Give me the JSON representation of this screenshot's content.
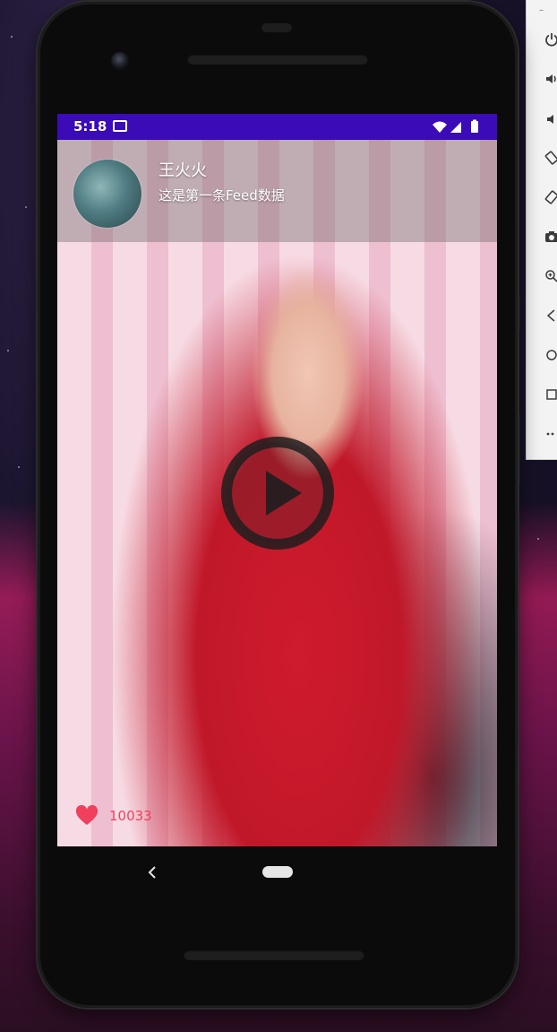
{
  "status_bar": {
    "time": "5:18"
  },
  "feed": {
    "author_name": "王火火",
    "description": "这是第一条Feed数据",
    "like_count": "10033"
  },
  "emulator_toolbar": {
    "items": [
      "power-icon",
      "volume-up-icon",
      "volume-down-icon",
      "rotate-left-icon",
      "rotate-right-icon",
      "camera-icon",
      "zoom-icon",
      "back-icon",
      "home-icon",
      "overview-icon",
      "more-icon"
    ]
  },
  "colors": {
    "status_bar": "#3a0bb7",
    "like_accent": "#f0405e"
  }
}
